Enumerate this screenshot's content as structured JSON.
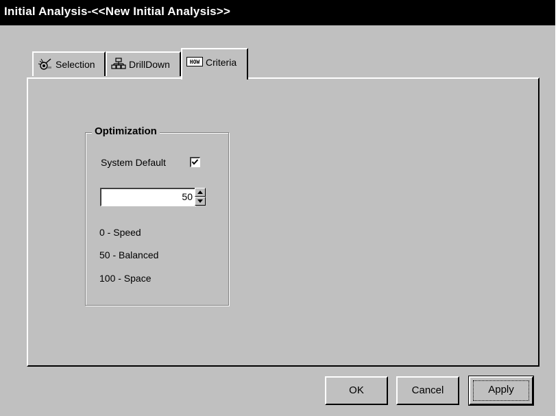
{
  "window": {
    "title": "Initial Analysis-<<New Initial Analysis>>"
  },
  "tabs": [
    {
      "label": "Selection",
      "icon": "selection-icon"
    },
    {
      "label": "DrillDown",
      "icon": "drilldown-icon"
    },
    {
      "label": "Criteria",
      "icon": "criteria-icon",
      "active": true
    }
  ],
  "optimization": {
    "group_title": "Optimization",
    "system_default_label": "System Default",
    "system_default_checked": true,
    "value": "50",
    "legend": [
      "0 - Speed",
      "50 - Balanced",
      "100 - Space"
    ]
  },
  "buttons": {
    "ok": "OK",
    "cancel": "Cancel",
    "apply": "Apply"
  },
  "colors": {
    "face": "#c0c0c0",
    "titlebar": "#000000"
  }
}
